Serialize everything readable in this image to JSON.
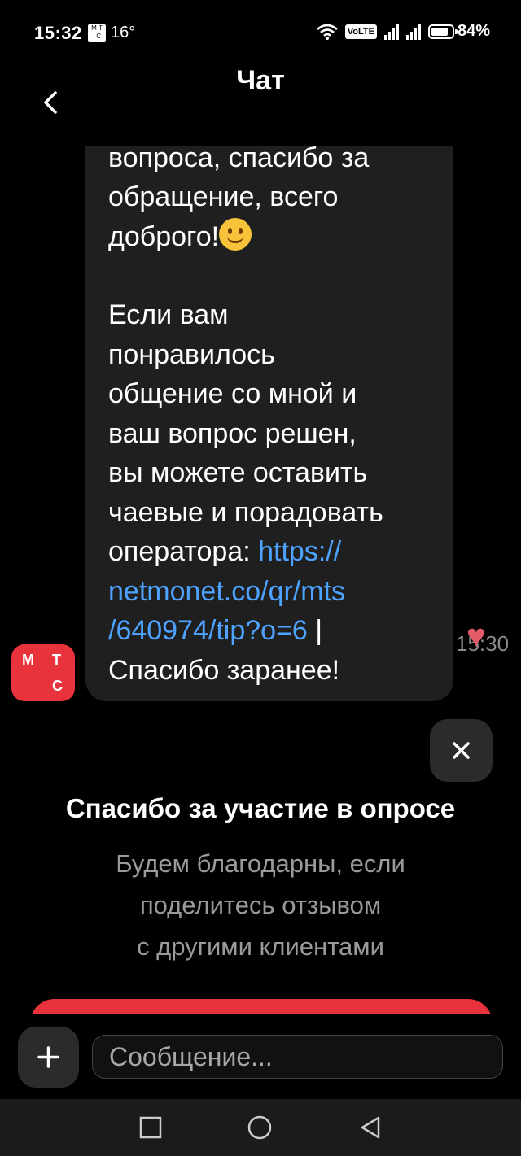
{
  "status_bar": {
    "time": "15:32",
    "carrier_icon": "mts-icon",
    "temperature": "16°",
    "volte": "VoLTE",
    "battery": "84%"
  },
  "header": {
    "title": "Чат"
  },
  "message": {
    "lines": [
      "вопроса, спасибо за",
      "обращение, всего",
      "доброго!"
    ],
    "tip_lines": [
      "Если вам",
      "понравилось",
      "общение со мной и",
      "ваш вопрос решен,",
      "вы можете оставить",
      "чаевые и порадовать"
    ],
    "link_prefix": "оператора: ",
    "link_line_1": "https://",
    "link_line_2": "netmonet.co/qr/mts",
    "link_line_3": "/640974/tip?o=6",
    "after_link": " |",
    "thanks": "Спасибо заранее!",
    "time": "15:30",
    "avatar_letters": [
      "М",
      "Т",
      "С"
    ]
  },
  "survey": {
    "title": "Спасибо за участие в опросе",
    "subtitle_lines": [
      "Будем благодарны, если",
      "поделитесь отзывом",
      "с другими клиентами"
    ]
  },
  "input": {
    "placeholder": "Сообщение..."
  },
  "colors": {
    "accent": "#e8323c",
    "link": "#4da3ff",
    "bubble": "#1f1f1f",
    "muted": "#9a9a9a"
  }
}
